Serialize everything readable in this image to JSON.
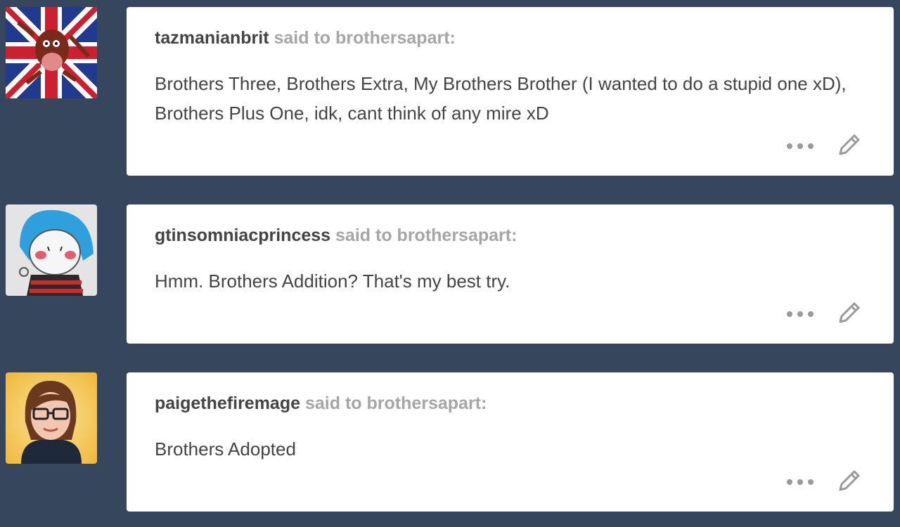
{
  "posts": [
    {
      "asker": "tazmanianbrit",
      "said_to": "said to brothersapart:",
      "text": "Brothers Three, Brothers Extra, My Brothers Brother (I wanted to do a stupid one xD), Brothers Plus One, idk, cant think of any mire xD",
      "avatar_icon": "taz-union-jack-avatar"
    },
    {
      "asker": "gtinsomniacprincess",
      "said_to": "said to brothersapart:",
      "text": "Hmm. Brothers Addition? That's my best try.",
      "avatar_icon": "blue-hair-drawing-avatar"
    },
    {
      "asker": "paigethefiremage",
      "said_to": "said to brothersapart:",
      "text": "Brothers Adopted",
      "avatar_icon": "glasses-portrait-avatar"
    }
  ],
  "icons": {
    "more": "more-options-icon",
    "edit": "pencil-icon"
  },
  "colors": {
    "background": "#36465d",
    "card": "#ffffff",
    "asker_text": "#444444",
    "said_to_text": "#a6a6a6",
    "icon": "#9a9a9a"
  }
}
